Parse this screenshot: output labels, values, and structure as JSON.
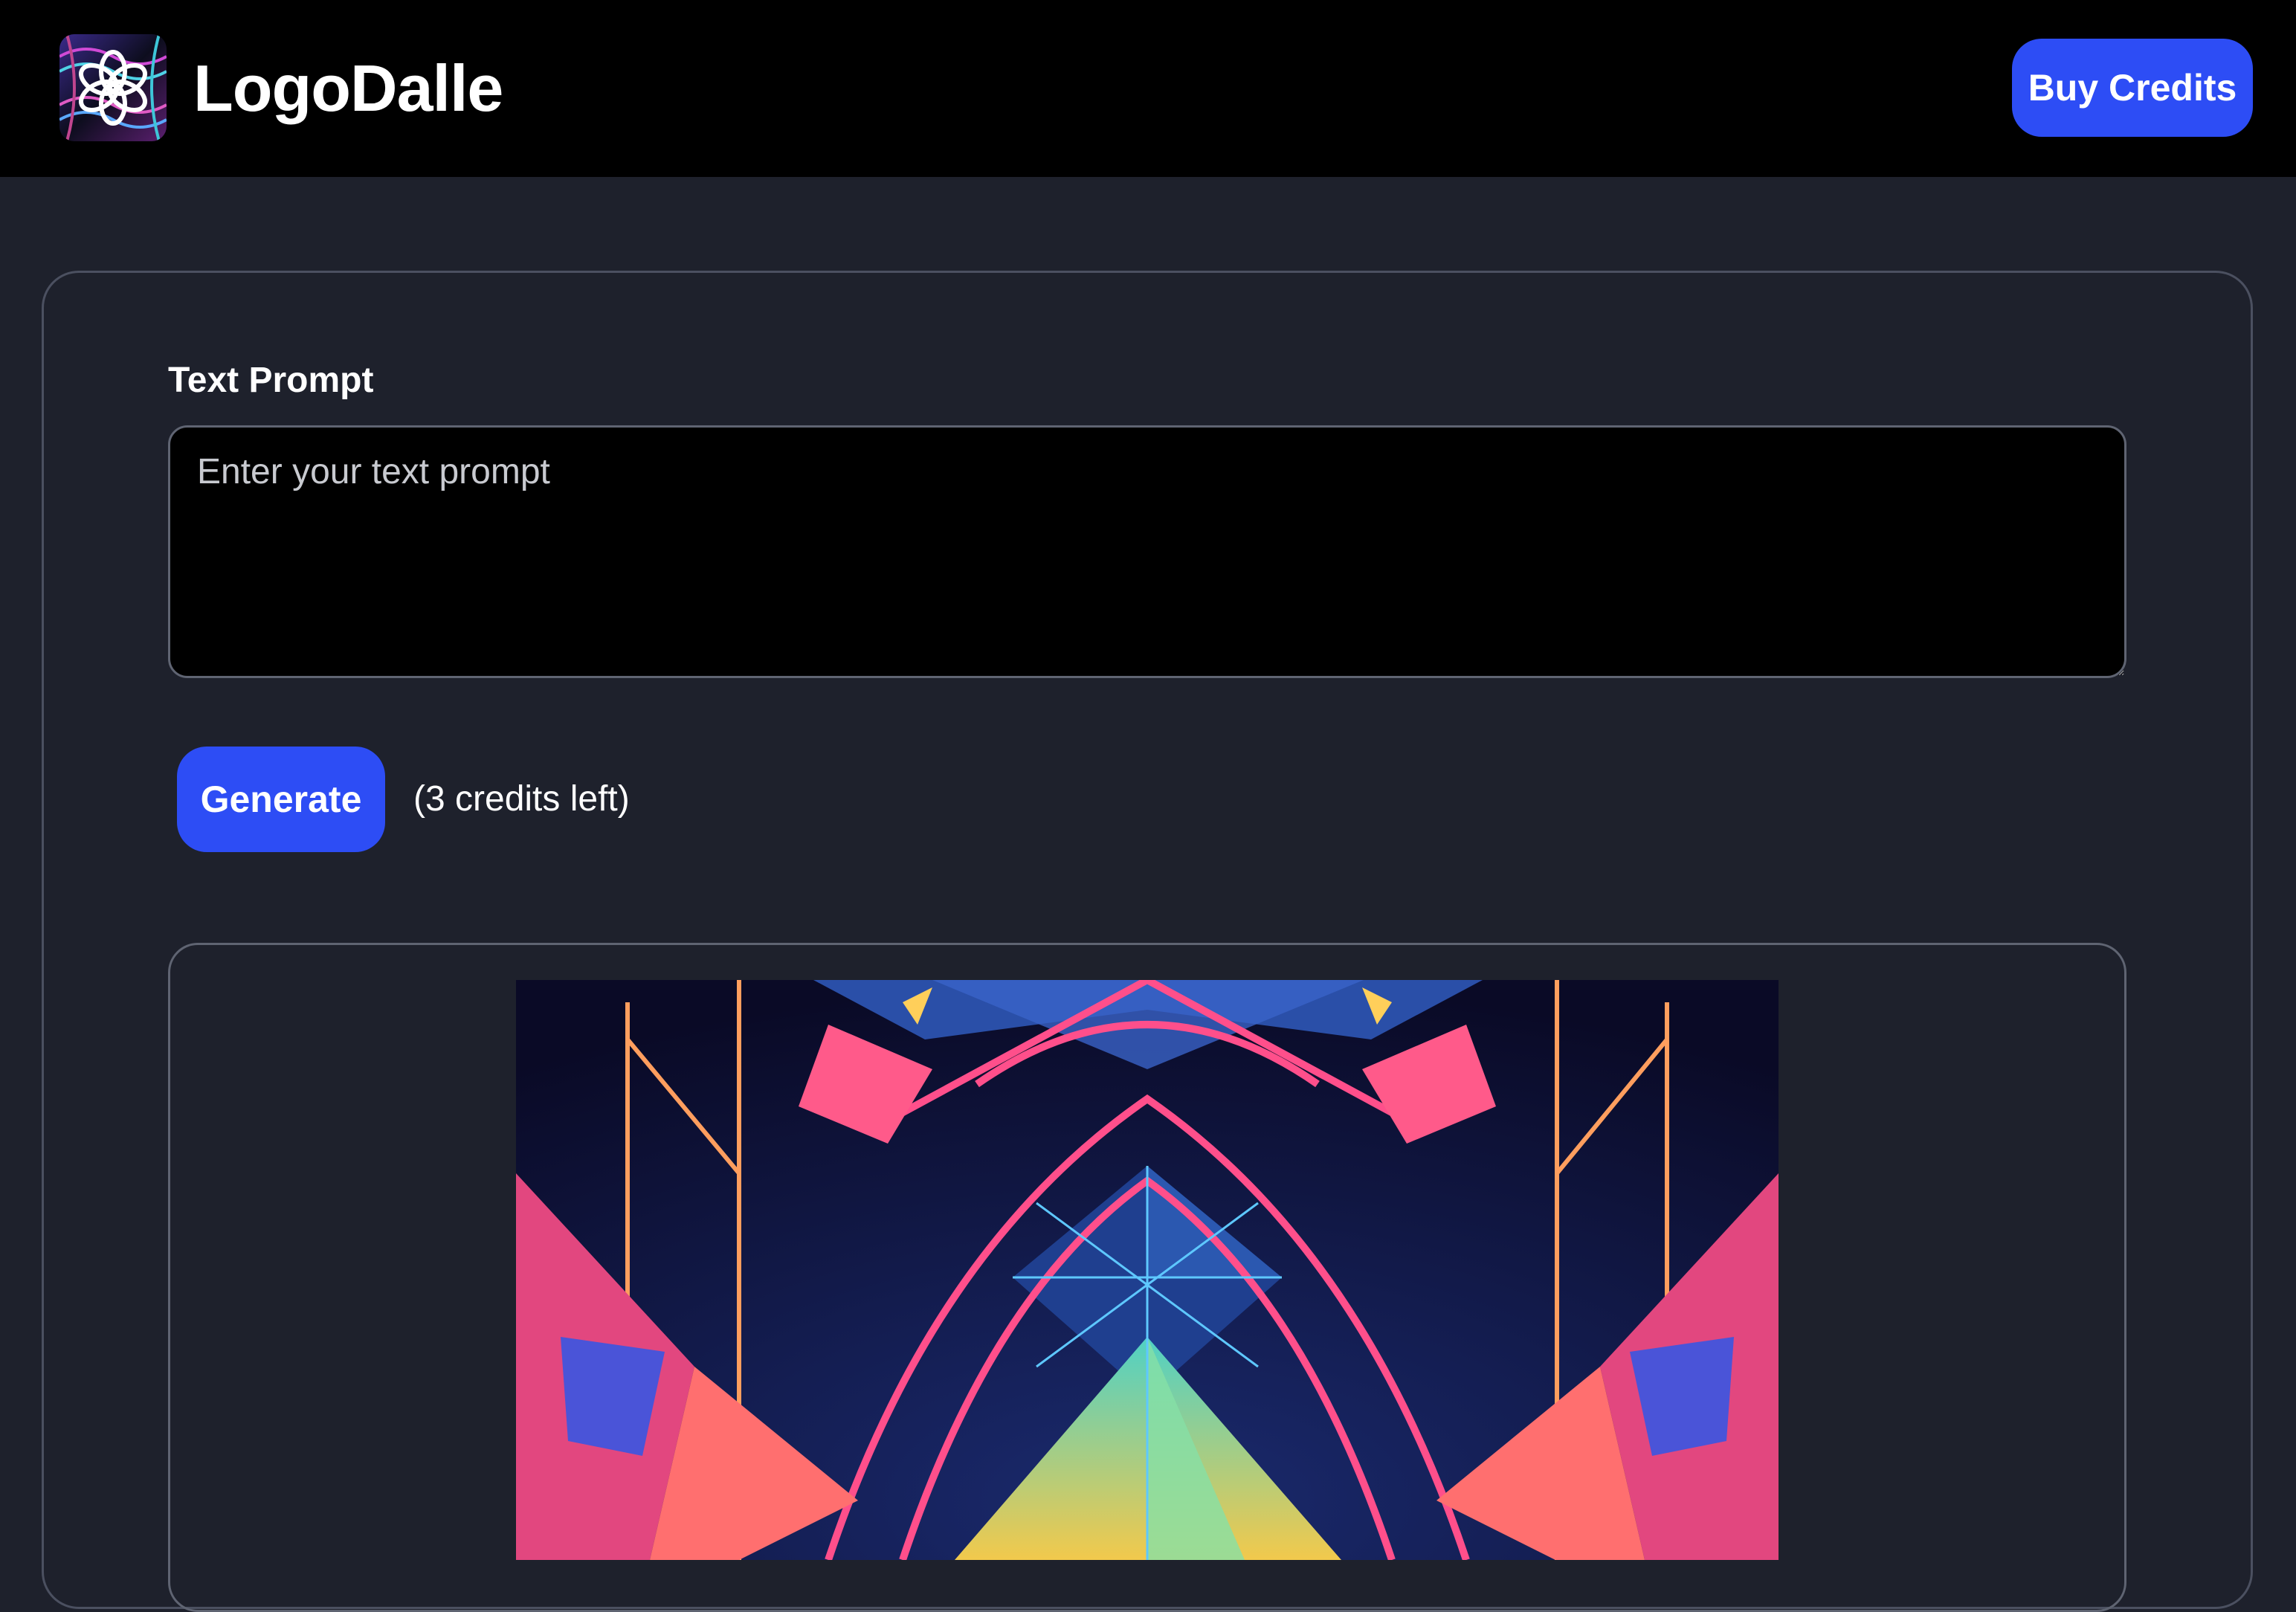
{
  "header": {
    "brand": "LogoDalle",
    "logo_icon": "openai-knot-icon",
    "buy_credits_label": "Buy Credits"
  },
  "form": {
    "prompt_label": "Text Prompt",
    "prompt_placeholder": "Enter your text prompt",
    "prompt_value": "",
    "generate_label": "Generate",
    "credits_text": "(3 credits left)"
  },
  "result": {
    "image_icon": "generated-geometric-neon-image"
  },
  "colors": {
    "header_bg": "#000000",
    "page_bg": "#1e212c",
    "accent": "#2d4df5",
    "input_bg": "#000000",
    "border": "#5f6472"
  }
}
